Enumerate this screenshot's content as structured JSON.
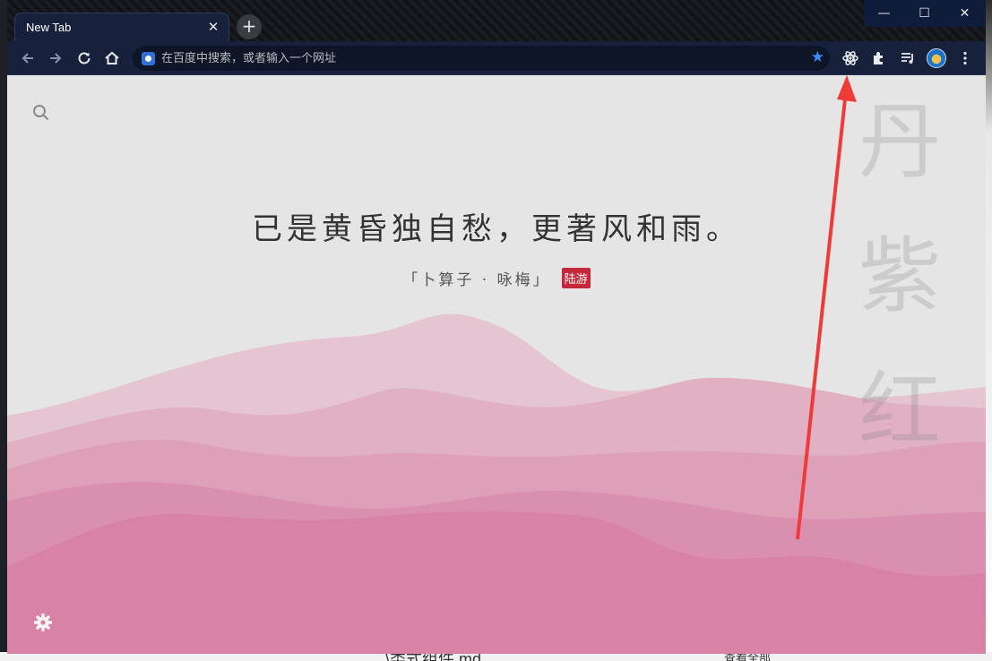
{
  "window": {
    "tab_title": "New Tab",
    "tab_close": "✕",
    "new_tab": "+",
    "controls": {
      "minimize": "—",
      "maximize": "☐",
      "close": "✕"
    }
  },
  "toolbar": {
    "omnibox_placeholder": "在百度中搜索，或者输入一个网址",
    "star": "★"
  },
  "page": {
    "poem_line": "已是黄昏独自愁，更著风和雨。",
    "source_title": "「卜算子 · 咏梅」",
    "author": "陆游",
    "color_name": [
      "丹",
      "紫",
      "红"
    ]
  },
  "desktop": {
    "file_label": "\\类式组件.md",
    "other_label": "查看全部"
  },
  "colors": {
    "page_bg": "#e6e5e6",
    "wave_colors": [
      "#e4c5d1",
      "#e1b0c3",
      "#de9fb8",
      "#db8fae",
      "#d882a6"
    ],
    "annotation_arrow": "#f03a3a",
    "author_badge": "#c5283a",
    "toolbar_bg": "#17213b"
  }
}
